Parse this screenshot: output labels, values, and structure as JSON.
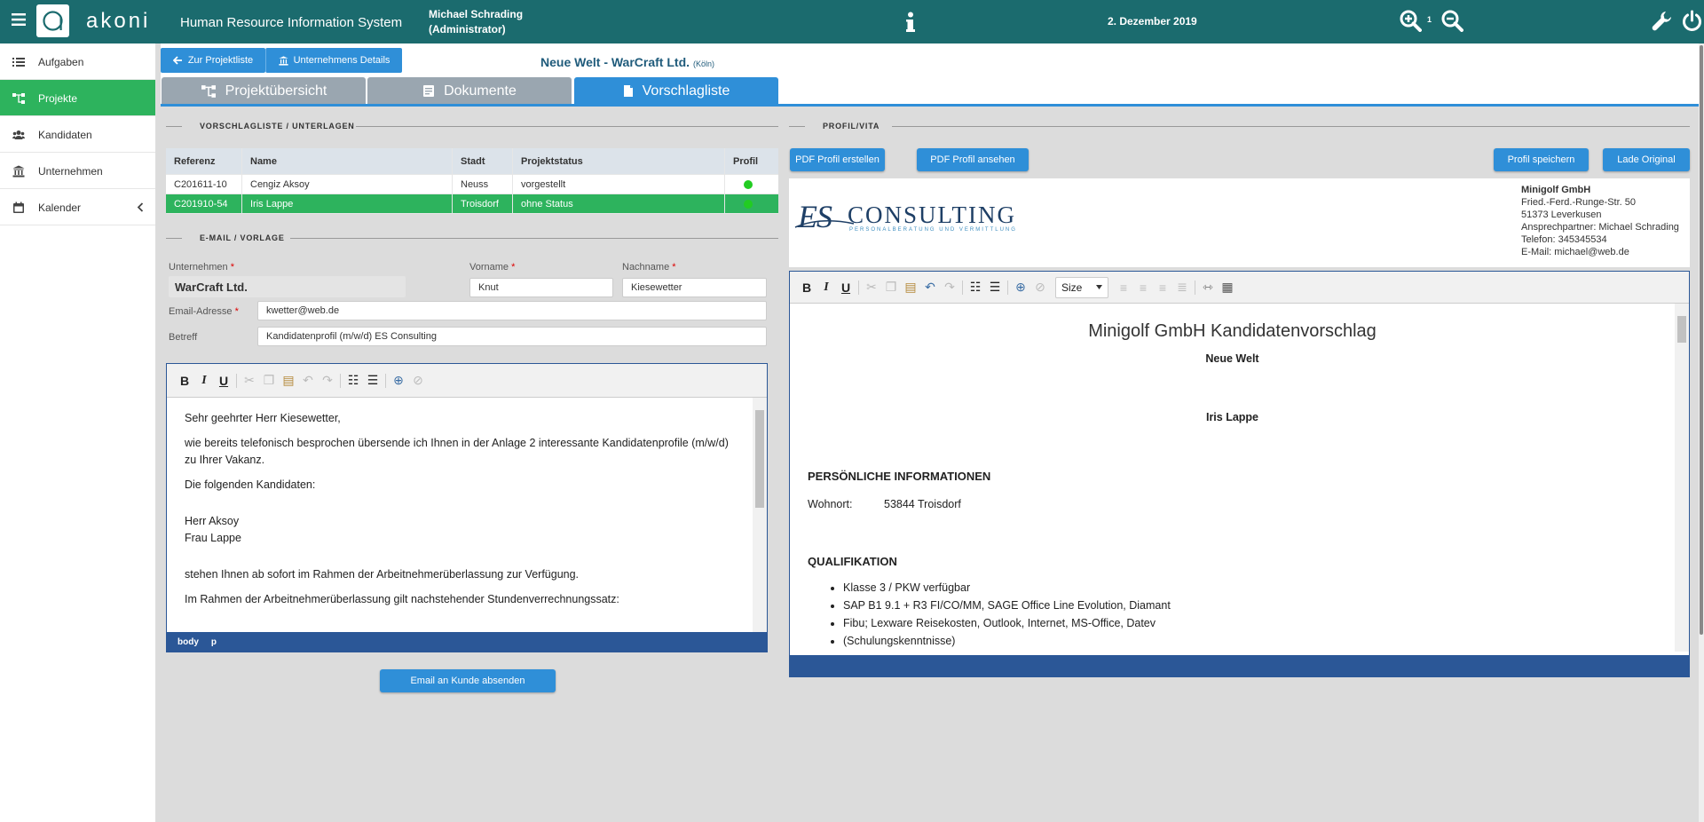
{
  "topbar": {
    "brand": "akoni",
    "system_name": "Human Resource Information System",
    "user_name": "Michael Schrading",
    "user_role": "(Administrator)",
    "date": "2. Dezember 2019",
    "zoom_level": "1"
  },
  "sidebar": {
    "items": [
      {
        "label": "Aufgaben",
        "icon": "tasks-icon"
      },
      {
        "label": "Projekte",
        "icon": "sitemap-icon",
        "active": true
      },
      {
        "label": "Kandidaten",
        "icon": "users-icon"
      },
      {
        "label": "Unternehmen",
        "icon": "bank-icon"
      },
      {
        "label": "Kalender",
        "icon": "calendar-icon"
      }
    ]
  },
  "header": {
    "back_label": "Zur Projektliste",
    "company_label": "Unternehmens Details",
    "project_title": "Neue Welt - WarCraft Ltd.",
    "project_city": "(Köln)",
    "tabs": [
      {
        "label": "Projektübersicht"
      },
      {
        "label": "Dokumente"
      },
      {
        "label": "Vorschlagliste",
        "active": true
      }
    ]
  },
  "left": {
    "section_list": "VORSCHLAGLISTE / UNTERLAGEN",
    "section_email": "E-MAIL / VORLAGE",
    "table": {
      "headers": [
        "Referenz",
        "Name",
        "Stadt",
        "Projektstatus",
        "Profil"
      ],
      "rows": [
        [
          "C201611-10",
          "Cengiz Aksoy",
          "Neuss",
          "vorgestellt"
        ],
        [
          "C201910-54",
          "Iris Lappe",
          "Troisdorf",
          "ohne Status"
        ]
      ]
    },
    "form": {
      "company_label": "Unternehmen",
      "company_value": "WarCraft Ltd.",
      "firstname_label": "Vorname",
      "firstname_value": "Knut",
      "lastname_label": "Nachname",
      "lastname_value": "Kiesewetter",
      "email_label": "Email-Adresse",
      "email_value": "kwetter@web.de",
      "subject_label": "Betreff",
      "subject_value": "Kandidatenprofil (m/w/d) ES Consulting",
      "required_mark": "*"
    },
    "email_body": [
      "Sehr geehrter Herr Kiesewetter,",
      "wie bereits telefonisch besprochen übersende ich Ihnen in der Anlage 2 interessante Kandidatenprofile (m/w/d) zu Ihrer Vakanz.",
      "Die folgenden Kandidaten:",
      "Herr Aksoy",
      "Frau Lappe",
      "stehen Ihnen ab sofort im Rahmen der Arbeitnehmerüberlassung zur Verfügung.",
      "Im Rahmen der Arbeitnehmerüberlassung gilt nachstehender Stundenverrechnungssatz:"
    ],
    "status_path": [
      "body",
      "p"
    ],
    "send_label": "Email an Kunde absenden"
  },
  "right": {
    "section_profile": "PROFIL/VITA",
    "btn_create_pdf": "PDF Profil erstellen",
    "btn_view_pdf": "PDF Profil ansehen",
    "btn_save": "Profil speichern",
    "btn_original": "Lade Original",
    "logo_es": "ES",
    "logo_consulting": "CONSULTING",
    "logo_sub": "PERSONALBERATUNG UND VERMITTLUNG",
    "address": {
      "company": "Minigolf GmbH",
      "street": "Fried.-Ferd.-Runge-Str. 50",
      "city": "51373 Leverkusen",
      "contact": "Ansprechpartner: Michael Schrading",
      "phone": "Telefon: 345345534",
      "email": "E-Mail: michael@web.de"
    },
    "size_label": "Size",
    "doc": {
      "title": "Minigolf GmbH Kandidatenvorschlag",
      "project": "Neue Welt",
      "candidate": "Iris Lappe",
      "section_personal": "PERSÖNLICHE INFORMATIONEN",
      "wohnort_label": "Wohnort:",
      "wohnort_value": "53844 Troisdorf",
      "section_qual": "QUALIFIKATION",
      "qualifications": [
        "Klasse 3 / PKW verfügbar",
        "SAP B1 9.1 + R3 FI/CO/MM, SAGE Office Line Evolution, Diamant",
        "Fibu; Lexware Reisekosten, Outlook, Internet, MS-Office, Datev",
        "(Schulungskenntnisse)"
      ]
    }
  },
  "colors": {
    "topbar": "#1b6b6e",
    "accent_blue": "#2f8fd8",
    "active_green": "#2db35d",
    "editor_blue": "#2b5797",
    "status_dot": "#22cc22"
  }
}
